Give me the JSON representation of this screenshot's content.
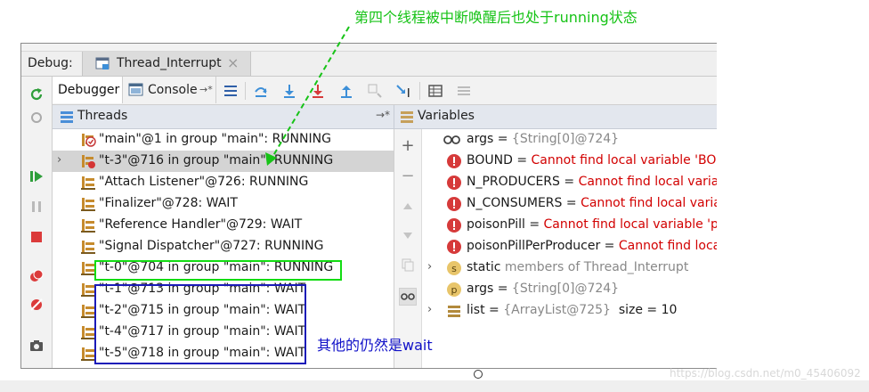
{
  "annotations": {
    "top_note": "第四个线程被中断唤醒后也处于running状态",
    "blue_note": "其他的仍然是wait",
    "green_color": "#12dc12",
    "blue_color": "#1a1ab8"
  },
  "debug_bar": {
    "label": "Debug:",
    "session_tab": "Thread_Interrupt",
    "close_glyph": "×"
  },
  "tabs": {
    "debugger": "Debugger",
    "console": "Console",
    "console_pin": "→*"
  },
  "threads": {
    "title": "Threads",
    "pin": "→*",
    "expander": "›",
    "rows": [
      {
        "label": "\"main\"@1 in group \"main\": RUNNING",
        "icon": "thread-current-icon",
        "selected": false,
        "expandable": false
      },
      {
        "label": "\"t-3\"@716 in group \"main\": RUNNING",
        "icon": "thread-suspended-icon",
        "selected": true,
        "expandable": true
      },
      {
        "label": "\"Attach Listener\"@726: RUNNING",
        "icon": "thread-icon",
        "selected": false,
        "expandable": false
      },
      {
        "label": "\"Finalizer\"@728: WAIT",
        "icon": "thread-icon",
        "selected": false,
        "expandable": false
      },
      {
        "label": "\"Reference Handler\"@729: WAIT",
        "icon": "thread-icon",
        "selected": false,
        "expandable": false
      },
      {
        "label": "\"Signal Dispatcher\"@727: RUNNING",
        "icon": "thread-icon",
        "selected": false,
        "expandable": false
      },
      {
        "label": "\"t-0\"@704 in group \"main\": RUNNING",
        "icon": "thread-icon",
        "selected": false,
        "expandable": false
      },
      {
        "label": "\"t-1\"@713 in group \"main\": WAIT",
        "icon": "thread-icon",
        "selected": false,
        "expandable": false
      },
      {
        "label": "\"t-2\"@715 in group \"main\": WAIT",
        "icon": "thread-icon",
        "selected": false,
        "expandable": false
      },
      {
        "label": "\"t-4\"@717 in group \"main\": WAIT",
        "icon": "thread-icon",
        "selected": false,
        "expandable": false
      },
      {
        "label": "\"t-5\"@718 in group \"main\": WAIT",
        "icon": "thread-icon",
        "selected": false,
        "expandable": false
      }
    ]
  },
  "variables": {
    "title": "Variables",
    "rows": [
      {
        "icon": "watch-infinity-icon",
        "name": "args",
        "sep": " = ",
        "value": "{String[0]@724}",
        "value_kind": "val",
        "expandable": false
      },
      {
        "icon": "error-icon",
        "name": "BOUND",
        "sep": " = ",
        "value": "Cannot find local variable 'BOUND'",
        "value_kind": "err",
        "expandable": false
      },
      {
        "icon": "error-icon",
        "name": "N_PRODUCERS",
        "sep": " = ",
        "value": "Cannot find local variable 'N_PRODUCERS'",
        "value_kind": "err",
        "expandable": false
      },
      {
        "icon": "error-icon",
        "name": "N_CONSUMERS",
        "sep": " = ",
        "value": "Cannot find local variable 'N_CONSUMERS'",
        "value_kind": "err",
        "expandable": false
      },
      {
        "icon": "error-icon",
        "name": "poisonPill",
        "sep": " = ",
        "value": "Cannot find local variable 'poisonPill'",
        "value_kind": "err",
        "expandable": false
      },
      {
        "icon": "error-icon",
        "name": "poisonPillPerProducer",
        "sep": " = ",
        "value": "Cannot find local variable 'poisonPillPerProducer'",
        "value_kind": "err",
        "expandable": false
      },
      {
        "icon": "static-s-icon",
        "name": "static",
        "sep": " ",
        "value": "members of Thread_Interrupt",
        "value_kind": "val",
        "expandable": true
      },
      {
        "icon": "parameter-p-icon",
        "name": "args",
        "sep": " = ",
        "value": "{String[0]@724}",
        "value_kind": "val",
        "expandable": false
      },
      {
        "icon": "list-field-icon",
        "name": "list",
        "sep": " = ",
        "value": "{ArrayList@725}",
        "value_kind": "val",
        "extra": "size = 10",
        "expandable": true
      }
    ]
  },
  "watermark": "https://blog.csdn.net/m0_45406092"
}
